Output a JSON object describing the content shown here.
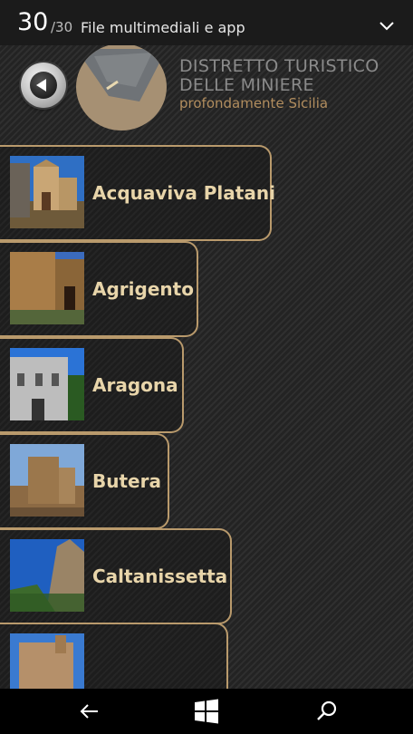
{
  "status_bar": {
    "current_index": "30",
    "total": "/30",
    "title": "File multimediali e app",
    "expand_icon": "chevron-down-icon"
  },
  "header": {
    "back_icon": "back-arrow-icon",
    "brand_line1": "DISTRETTO TURISTICO",
    "brand_line2": "DELLE MINIERE",
    "tagline": "profondamente Sicilia"
  },
  "towns": [
    {
      "label": "Acquaviva Platani"
    },
    {
      "label": "Agrigento"
    },
    {
      "label": "Aragona"
    },
    {
      "label": "Butera"
    },
    {
      "label": "Caltanissetta"
    },
    {
      "label": ""
    }
  ],
  "nav": {
    "back_icon": "back-arrow-icon",
    "windows_icon": "windows-logo-icon",
    "search_icon": "search-icon"
  },
  "colors": {
    "accent_gold": "#b99a6c",
    "label_cream": "#e8d5aa",
    "logo_tan": "#a69073",
    "tagline_bronze": "#b18d5e"
  }
}
